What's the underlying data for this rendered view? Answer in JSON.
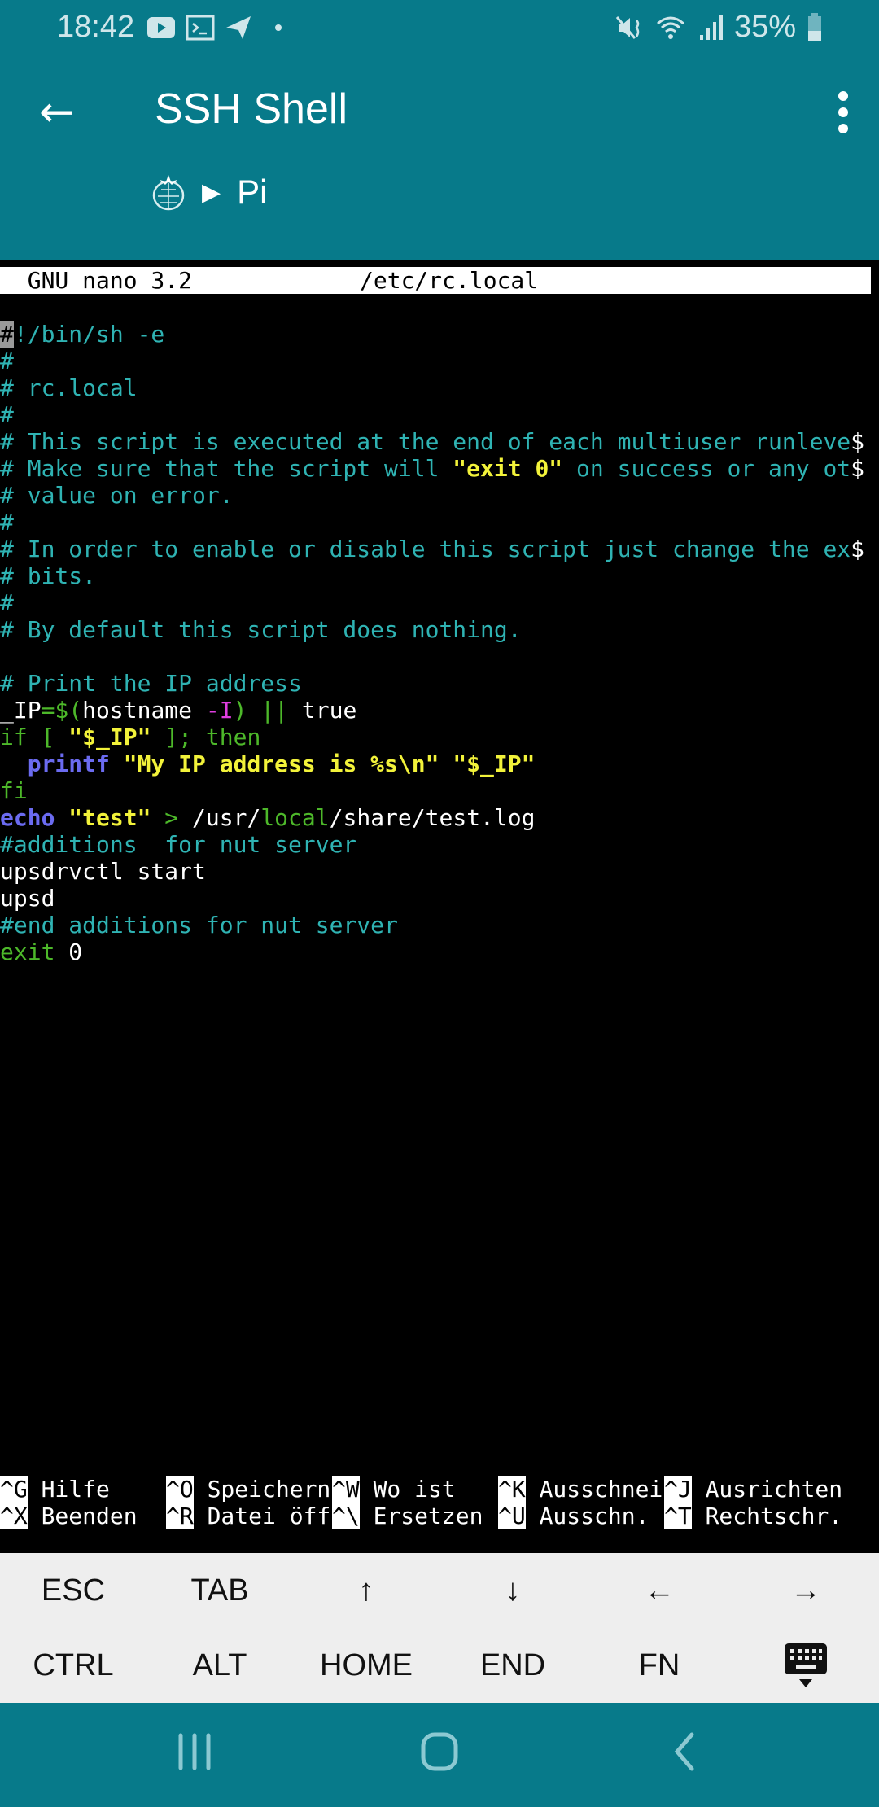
{
  "status_bar": {
    "time": "18:42",
    "battery": "35%",
    "icons": [
      "youtube-icon",
      "terminal-icon",
      "telegram-icon",
      "dot-icon",
      "mute-icon",
      "wifi-icon",
      "signal-icon",
      "battery-icon"
    ]
  },
  "header": {
    "title": "SSH Shell",
    "breadcrumb_host": "Pi",
    "host_icon": "raspberry-pi-icon"
  },
  "nano": {
    "title_left": "  GNU nano 3.2",
    "title_file": "/etc/rc.local",
    "lines": [
      [],
      [
        [
          "#",
          "cur"
        ],
        [
          "!/bin/sh -e",
          "c"
        ]
      ],
      [
        [
          "#",
          "c"
        ]
      ],
      [
        [
          "# rc.local",
          "c"
        ]
      ],
      [
        [
          "#",
          "c"
        ]
      ],
      [
        [
          "# This script is executed at the end of each multiuser runleve",
          "c"
        ],
        [
          "$",
          "w"
        ]
      ],
      [
        [
          "# Make sure that the script will ",
          "c"
        ],
        [
          "\"exit 0\"",
          "y"
        ],
        [
          " on success or any ot",
          "c"
        ],
        [
          "$",
          "w"
        ]
      ],
      [
        [
          "# value on error.",
          "c"
        ]
      ],
      [
        [
          "#",
          "c"
        ]
      ],
      [
        [
          "# In order to enable or disable this script just change the ex",
          "c"
        ],
        [
          "$",
          "w"
        ]
      ],
      [
        [
          "# bits.",
          "c"
        ]
      ],
      [
        [
          "#",
          "c"
        ]
      ],
      [
        [
          "# By default this script does nothing.",
          "c"
        ]
      ],
      [],
      [
        [
          "# Print the IP address",
          "c"
        ]
      ],
      [
        [
          "_IP",
          "w"
        ],
        [
          "=$(",
          "g"
        ],
        [
          "hostname ",
          "w"
        ],
        [
          "-I",
          "m"
        ],
        [
          ")",
          "g"
        ],
        [
          " || ",
          "g"
        ],
        [
          "true",
          "w"
        ]
      ],
      [
        [
          "if [ ",
          "g"
        ],
        [
          "\"$_IP\"",
          "y"
        ],
        [
          " ]; then",
          "g"
        ]
      ],
      [
        [
          "  ",
          "w"
        ],
        [
          "printf",
          "b"
        ],
        [
          " ",
          "w"
        ],
        [
          "\"My IP address is %s\\n\" \"$_IP\"",
          "y"
        ]
      ],
      [
        [
          "fi",
          "g"
        ]
      ],
      [
        [
          "echo",
          "b"
        ],
        [
          " ",
          "w"
        ],
        [
          "\"test\"",
          "y"
        ],
        [
          " > ",
          "g"
        ],
        [
          "/usr/",
          "w"
        ],
        [
          "local",
          "g"
        ],
        [
          "/share/test.log",
          "w"
        ]
      ],
      [
        [
          "#additions  for nut server",
          "c"
        ]
      ],
      [
        [
          "upsdrvctl start",
          "w"
        ]
      ],
      [
        [
          "upsd",
          "w"
        ]
      ],
      [
        [
          "#end additions for nut server",
          "c"
        ]
      ],
      [
        [
          "exit",
          "g"
        ],
        [
          " 0",
          "w"
        ]
      ]
    ],
    "shortcuts": [
      [
        {
          "key": "^G",
          "label": " Hilfe"
        },
        {
          "key": "^O",
          "label": " Speichern"
        },
        {
          "key": "^W",
          "label": " Wo ist"
        },
        {
          "key": "^K",
          "label": " Ausschnei"
        },
        {
          "key": "^J",
          "label": " Ausrichten"
        }
      ],
      [
        {
          "key": "^X",
          "label": " Beenden"
        },
        {
          "key": "^R",
          "label": " Datei öff"
        },
        {
          "key": "^\\",
          "label": " Ersetzen"
        },
        {
          "key": "^U",
          "label": " Ausschn."
        },
        {
          "key": "^T",
          "label": " Rechtschr."
        }
      ]
    ]
  },
  "extra_keys": [
    [
      "ESC",
      "TAB",
      "↑",
      "↓",
      "←",
      "→"
    ],
    [
      "CTRL",
      "ALT",
      "HOME",
      "END",
      "FN",
      ""
    ]
  ],
  "colors": {
    "accent": "#077a8a",
    "comment": "#2fb3b3",
    "keyword": "#4db82a",
    "string": "#f2f23a",
    "builtin": "#6b6bf0",
    "option": "#e03ee0"
  }
}
